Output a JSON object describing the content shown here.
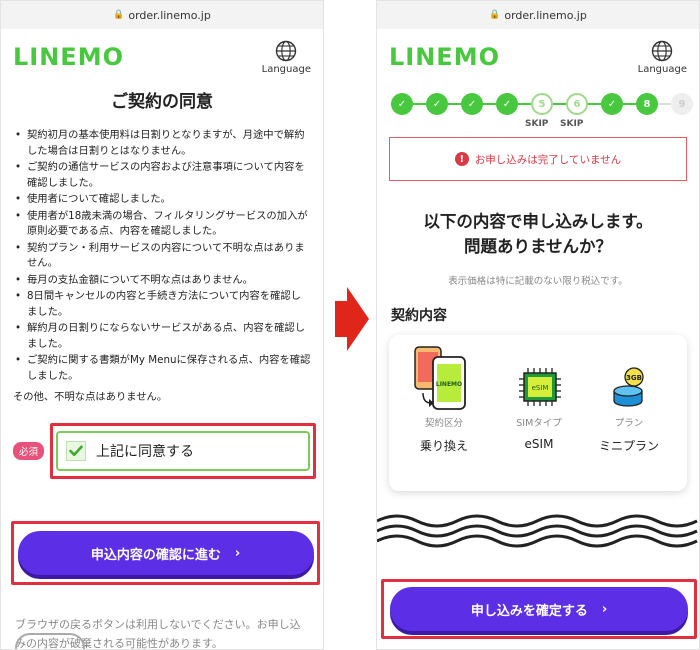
{
  "browser": {
    "url": "order.linemo.jp"
  },
  "header": {
    "logo": "LINEMO",
    "language_label": "Language"
  },
  "left": {
    "title": "ご契約の同意",
    "terms": [
      "契約初月の基本使用料は日割りとなりますが、月途中で解約した場合は日割りとはなりません。",
      "ご契約の通信サービスの内容および注意事項について内容を確認しました。",
      "使用者について確認しました。",
      "使用者が18歳未満の場合、フィルタリングサービスの加入が原則必要である点、内容を確認しました。",
      "契約プラン・利用サービスの内容について不明な点はありません。",
      "毎月の支払金額について不明な点はありません。",
      "8日間キャンセルの内容と手続き方法について内容を確認しました。",
      "解約月の日割りにならないサービスがある点、内容を確認しました。",
      "ご契約に関する書類がMy Menuに保存される点、内容を確認しました。"
    ],
    "other": "その他、不明な点はありません。",
    "required_badge": "必須",
    "agree_label": "上記に同意する",
    "agree_checked": true,
    "proceed_button": "申込内容の確認に進む",
    "warning": "ブラウザの戻るボタンは利用しないでください。お申し込みの内容が破棄される可能性があります。"
  },
  "right": {
    "steps": [
      {
        "label": "",
        "state": "done"
      },
      {
        "label": "",
        "state": "done"
      },
      {
        "label": "",
        "state": "done"
      },
      {
        "label": "",
        "state": "done"
      },
      {
        "label": "5",
        "state": "skip"
      },
      {
        "label": "6",
        "state": "skip"
      },
      {
        "label": "",
        "state": "done"
      },
      {
        "label": "8",
        "state": "current"
      },
      {
        "label": "9",
        "state": "todo"
      }
    ],
    "skip_label": "SKIP",
    "alert": "お申し込みは完了していません",
    "confirm_title_line1": "以下の内容で申し込みします。",
    "confirm_title_line2": "問題ありませんか？",
    "tax_note": "表示価格は特に記載のない限り税込です。",
    "section_title": "契約内容",
    "contract_items": [
      {
        "caption": "契約区分",
        "value": "乗り換え",
        "icon": "phone-transfer-icon"
      },
      {
        "caption": "SIMタイプ",
        "value": "eSIM",
        "icon": "esim-chip-icon"
      },
      {
        "caption": "プラン",
        "value": "ミニプラン",
        "icon": "mini-plan-icon"
      }
    ],
    "phone_screen_text": "LINEMO",
    "esim_chip_text": "eSIM",
    "plan_icon_text": "3GB",
    "confirm_button": "申し込みを確定する"
  },
  "colors": {
    "brand_green": "#47c83e",
    "button_purple": "#5c2ee6",
    "highlight_red": "#e03040",
    "alert_red": "#d93a44",
    "badge_pink": "#e8527a"
  }
}
